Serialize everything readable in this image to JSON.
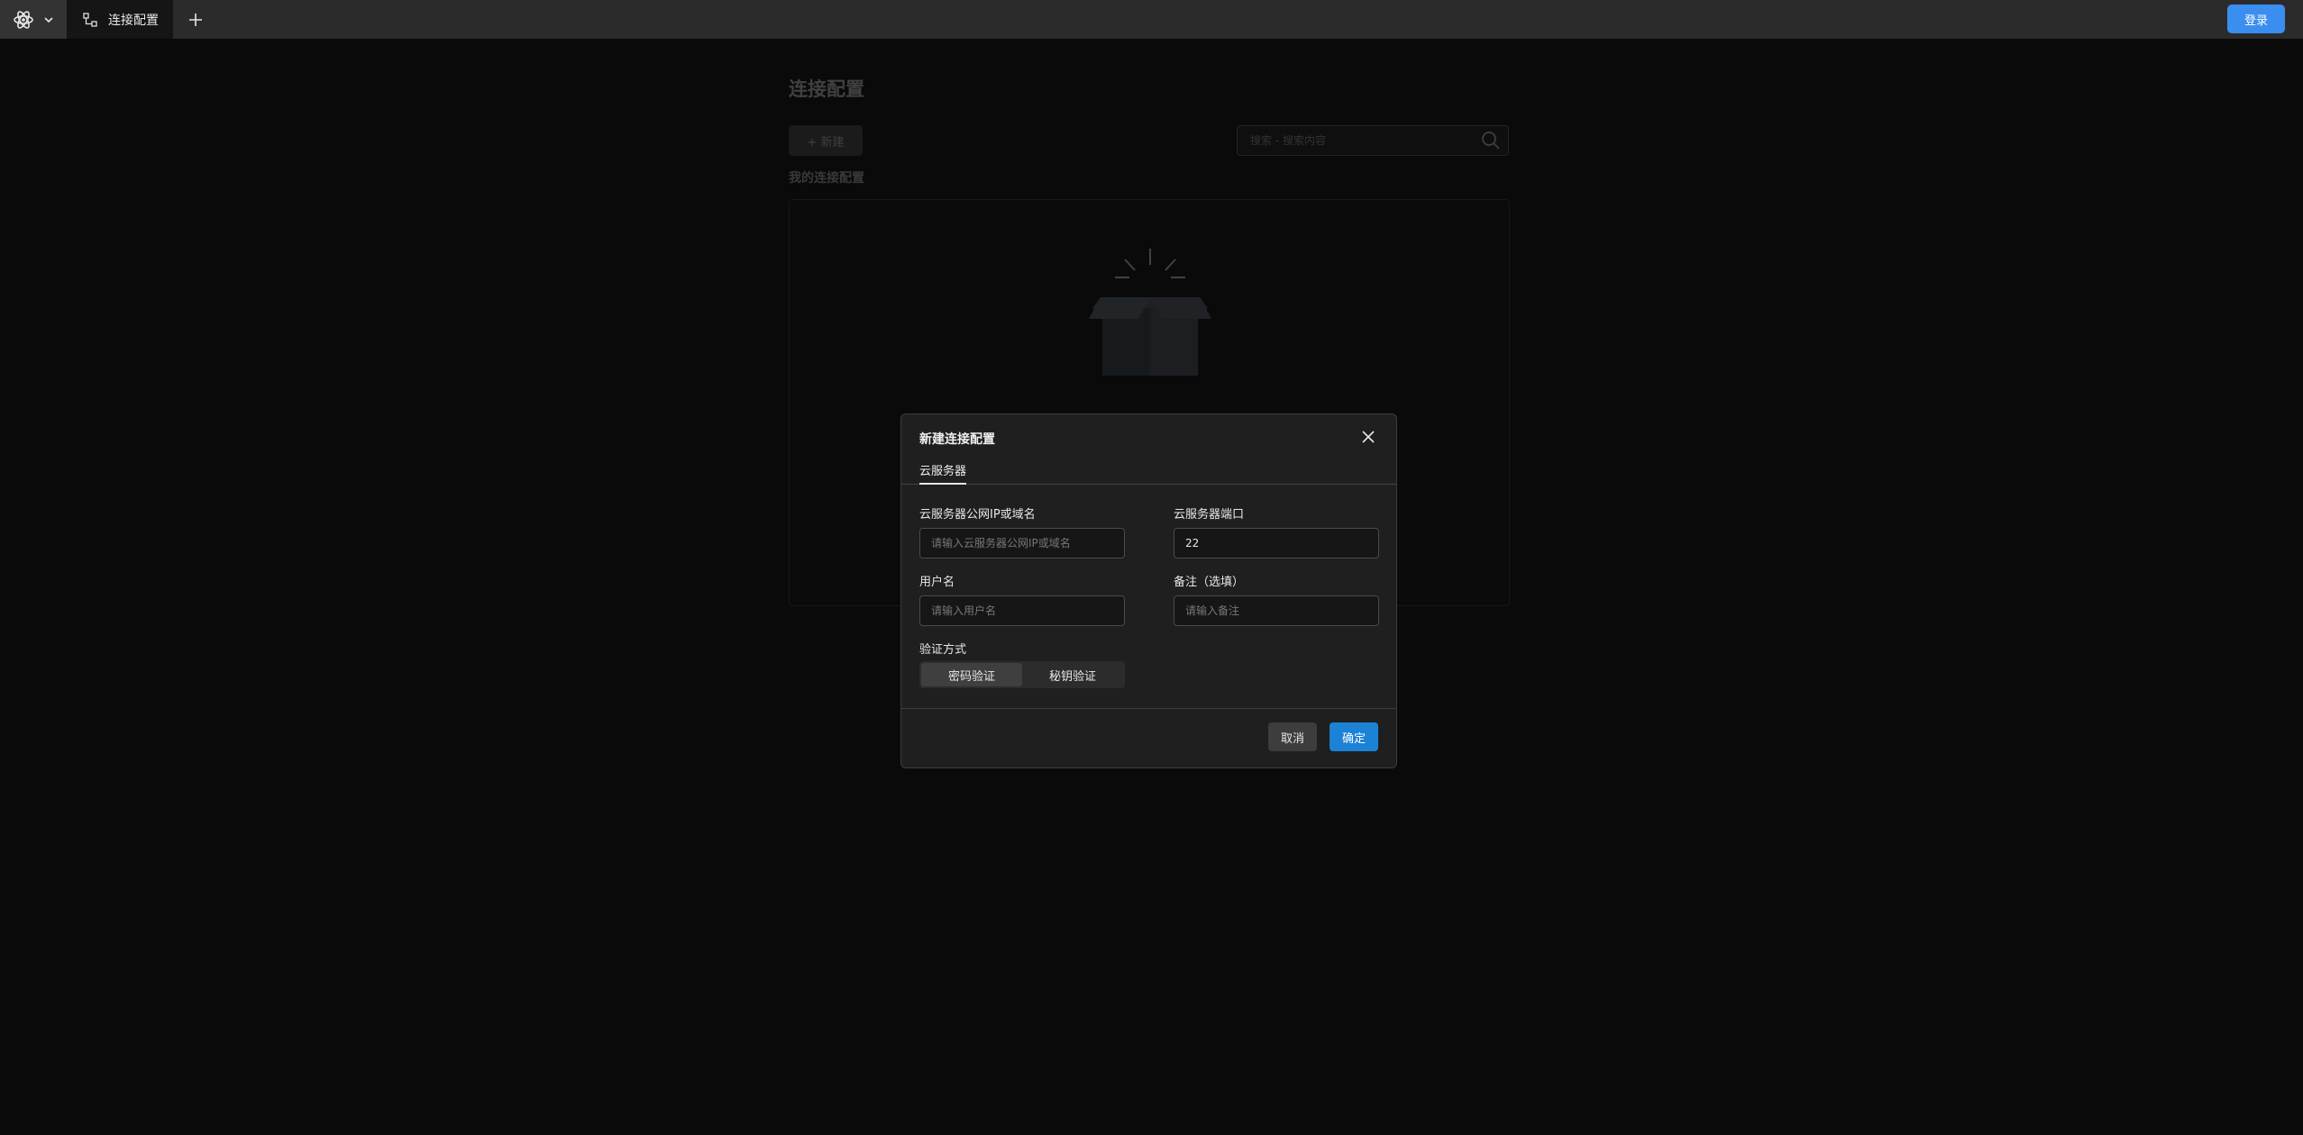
{
  "topbar": {
    "tab_label": "连接配置",
    "login_label": "登录"
  },
  "page": {
    "title": "连接配置",
    "new_button": "+ 新建",
    "search_placeholder": "搜索 - 搜索内容",
    "section_label": "我的连接配置"
  },
  "modal": {
    "title": "新建连接配置",
    "tab": "云服务器",
    "fields": {
      "host_label": "云服务器公网IP或域名",
      "host_placeholder": "请输入云服务器公网IP或域名",
      "port_label": "云服务器端口",
      "port_value": "22",
      "username_label": "用户名",
      "username_placeholder": "请输入用户名",
      "remark_label": "备注（选填）",
      "remark_placeholder": "请输入备注",
      "auth_label": "验证方式"
    },
    "auth_options": [
      "密码验证",
      "秘钥验证"
    ],
    "auth_selected": "密码验证",
    "cancel_label": "取消",
    "ok_label": "确定"
  },
  "colors": {
    "accent": "#1b82d6",
    "login": "#3a8ef0"
  }
}
